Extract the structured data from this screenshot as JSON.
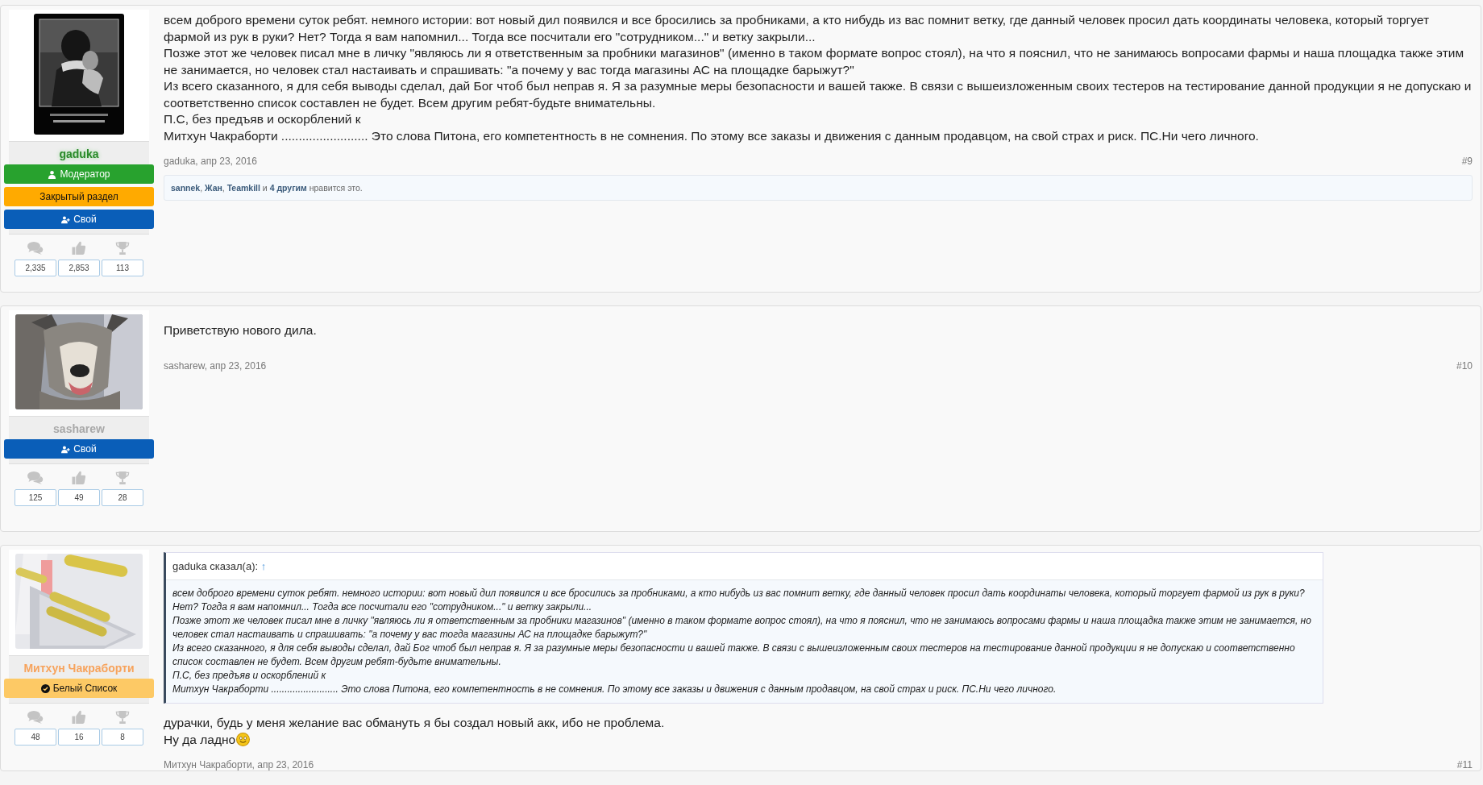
{
  "posts": [
    {
      "user": {
        "name": "gaduka",
        "color": "#2a8a2a",
        "glow": true
      },
      "badges": [
        {
          "kind": "moderator",
          "label": "Модератор",
          "color": "#28a22e"
        },
        {
          "kind": "plain",
          "label": "Закрытый раздел",
          "color": "#ffaa00"
        },
        {
          "kind": "own",
          "label": "Свой",
          "color": "#0a5eb8"
        }
      ],
      "stats": [
        {
          "kind": "messages",
          "value": "2,335"
        },
        {
          "kind": "likes",
          "value": "2,853"
        },
        {
          "kind": "trophies",
          "value": "113"
        }
      ],
      "body": [
        "всем доброго времени суток ребят. немного истории: вот новый дил появился и все бросились за пробниками, а кто нибудь из вас помнит ветку, где данный человек просил дать координаты человека, который торгует фармой из рук в руки? Нет? Тогда я вам напомнил... Тогда все посчитали его \"сотрудником...\" и ветку закрыли...",
        "Позже этот же человек писал мне в личку \"являюсь ли я ответственным за пробники магазинов\" (именно в таком формате вопрос стоял), на что я пояснил, что не занимаюсь вопросами фармы и наша площадка также этим не занимается, но человек стал настаивать и спрашивать: \"а почему у вас тогда магазины АС на площадке барыжут?\"",
        "Из всего сказанного, я для себя выводы сделал, дай Бог чтоб был неправ я. Я за разумные меры безопасности и вашей также. В связи с вышеизложенным своих тестеров на тестирование данной продукции я не допускаю и соответственно список составлен не будет. Всем другим ребят-будьте внимательны.",
        "П.С, без предъяв и оскорблений к",
        "Митхун Чакраборти ......................... Это слова Питона, его компетентность в не сомнения. По этому все заказы и движения с данным продавцом, на свой страх и риск. ПС.Ни чего личного."
      ],
      "ends_with_smiley": false,
      "byline": "gaduka, апр 23, 2016",
      "number": "#9",
      "likes": {
        "names": [
          "sannek",
          "Жан",
          "Teamkill"
        ],
        "separator": ",",
        "joiner": "и",
        "others": "4 другим",
        "suffix": "нравится это."
      }
    },
    {
      "user": {
        "name": "sasharew",
        "color": "#a8a8a8",
        "glow": false
      },
      "badges": [
        {
          "kind": "own",
          "label": "Свой",
          "color": "#0a5eb8"
        }
      ],
      "stats": [
        {
          "kind": "messages",
          "value": "125"
        },
        {
          "kind": "likes",
          "value": "49"
        },
        {
          "kind": "trophies",
          "value": "28"
        }
      ],
      "body": [
        "Приветствую нового дила."
      ],
      "ends_with_smiley": false,
      "byline": "sasharew, апр 23, 2016",
      "number": "#10"
    },
    {
      "user": {
        "name": "Митхун Чакраборти",
        "color": "#f7a35c",
        "glow": false
      },
      "badges": [
        {
          "kind": "whitelist",
          "label": "Белый Список",
          "color": "#fdc965"
        }
      ],
      "stats": [
        {
          "kind": "messages",
          "value": "48"
        },
        {
          "kind": "likes",
          "value": "16"
        },
        {
          "kind": "trophies",
          "value": "8"
        }
      ],
      "quote": {
        "attribution": "gaduka сказал(а):",
        "link": "↑",
        "body": [
          "всем доброго времени суток ребят. немного истории: вот новый дил появился и все бросились за пробниками, а кто нибудь из вас помнит ветку, где данный человек просил дать координаты человека, который торгует фармой из рук в руки? Нет? Тогда я вам напомнил... Тогда все посчитали его \"сотрудником...\" и ветку закрыли...",
          "Позже этот же человек писал мне в личку \"являюсь ли я ответственным за пробники магазинов\" (именно в таком формате вопрос стоял), на что я пояснил, что не занимаюсь вопросами фармы и наша площадка также этим не занимается, но человек стал настаивать и спрашивать: \"а почему у вас тогда магазины АС на площадке барыжут?\"",
          "Из всего сказанного, я для себя выводы сделал, дай Бог чтоб был неправ я. Я за разумные меры безопасности и вашей также. В связи с вышеизложенным своих тестеров на тестирование данной продукции я не допускаю и соответственно список составлен не будет. Всем другим ребят-будьте внимательны.",
          "П.С, без предъяв и оскорблений к",
          "Митхун Чакраборти ......................... Это слова Питона, его компетентность в не сомнения. По этому все заказы и движения с данным продавцом, на свой страх и риск. ПС.Ни чего личного."
        ]
      },
      "body": [
        "дурачки, будь у меня желание вас обмануть я бы создал новый акк, ибо не проблема.",
        "Ну да ладно"
      ],
      "ends_with_smiley": true,
      "byline": "Митхун Чакраборти, апр 23, 2016",
      "number": "#11"
    }
  ]
}
